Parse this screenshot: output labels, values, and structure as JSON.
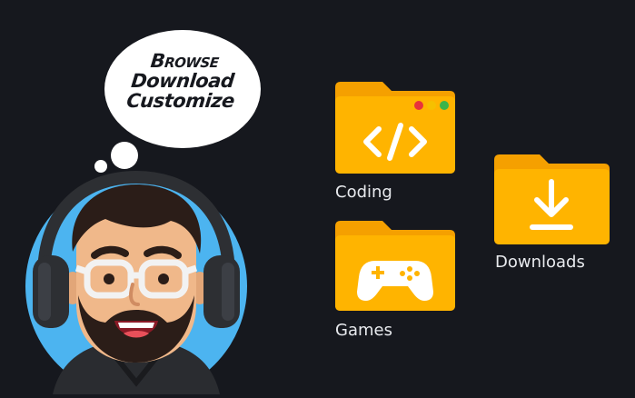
{
  "bubble": {
    "lines": [
      "Browse",
      "Download",
      "Customize"
    ]
  },
  "folders": [
    {
      "label": "Coding",
      "icon": "code-icon",
      "has_window_dots": true
    },
    {
      "label": "Games",
      "icon": "gamepad-icon",
      "has_window_dots": false
    },
    {
      "label": "Downloads",
      "icon": "download-arrow-icon",
      "has_window_dots": false
    }
  ],
  "colors": {
    "background": "#16181e",
    "folder_body": "#ffb400",
    "folder_tab": "#f5a000",
    "avatar_ring": "#4cb4f0",
    "dot_red": "#e8323c",
    "dot_yellow": "#f6c000",
    "dot_green": "#3cb44a"
  }
}
